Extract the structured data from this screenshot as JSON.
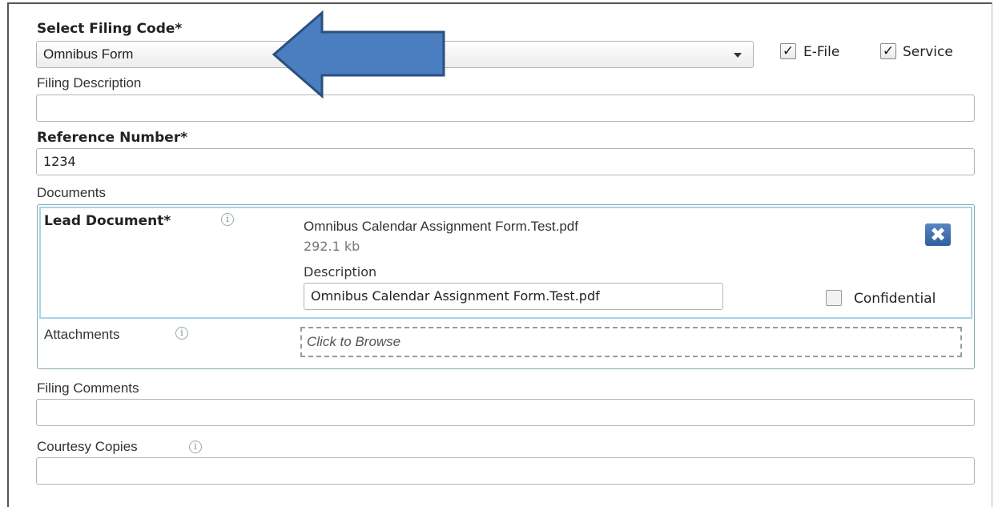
{
  "filing_code": {
    "label": "Select Filing Code*",
    "selected": "Omnibus Form"
  },
  "efile": {
    "label": "E-File",
    "checked": true,
    "check_glyph": "✓"
  },
  "service": {
    "label": "Service",
    "checked": true,
    "check_glyph": "✓"
  },
  "filing_description": {
    "label": "Filing Description",
    "value": ""
  },
  "reference_number": {
    "label": "Reference Number*",
    "value": "1234"
  },
  "documents": {
    "label": "Documents",
    "lead": {
      "label": "Lead Document*",
      "file_name": "Omnibus Calendar Assignment Form.Test.pdf",
      "file_size": "292.1 kb",
      "description_label": "Description",
      "description_value": "Omnibus Calendar Assignment Form.Test.pdf",
      "confidential_label": "Confidential"
    },
    "attachments": {
      "label": "Attachments",
      "browse_text": "Click to Browse"
    }
  },
  "filing_comments": {
    "label": "Filing Comments",
    "value": ""
  },
  "courtesy_copies": {
    "label": "Courtesy Copies",
    "value": ""
  },
  "icons": {
    "info": "i",
    "delete": "✖"
  },
  "colors": {
    "arrow": "#4a7ec1",
    "arrow_stroke": "#2b4f7e",
    "lead_border": "#a8d4e8"
  }
}
